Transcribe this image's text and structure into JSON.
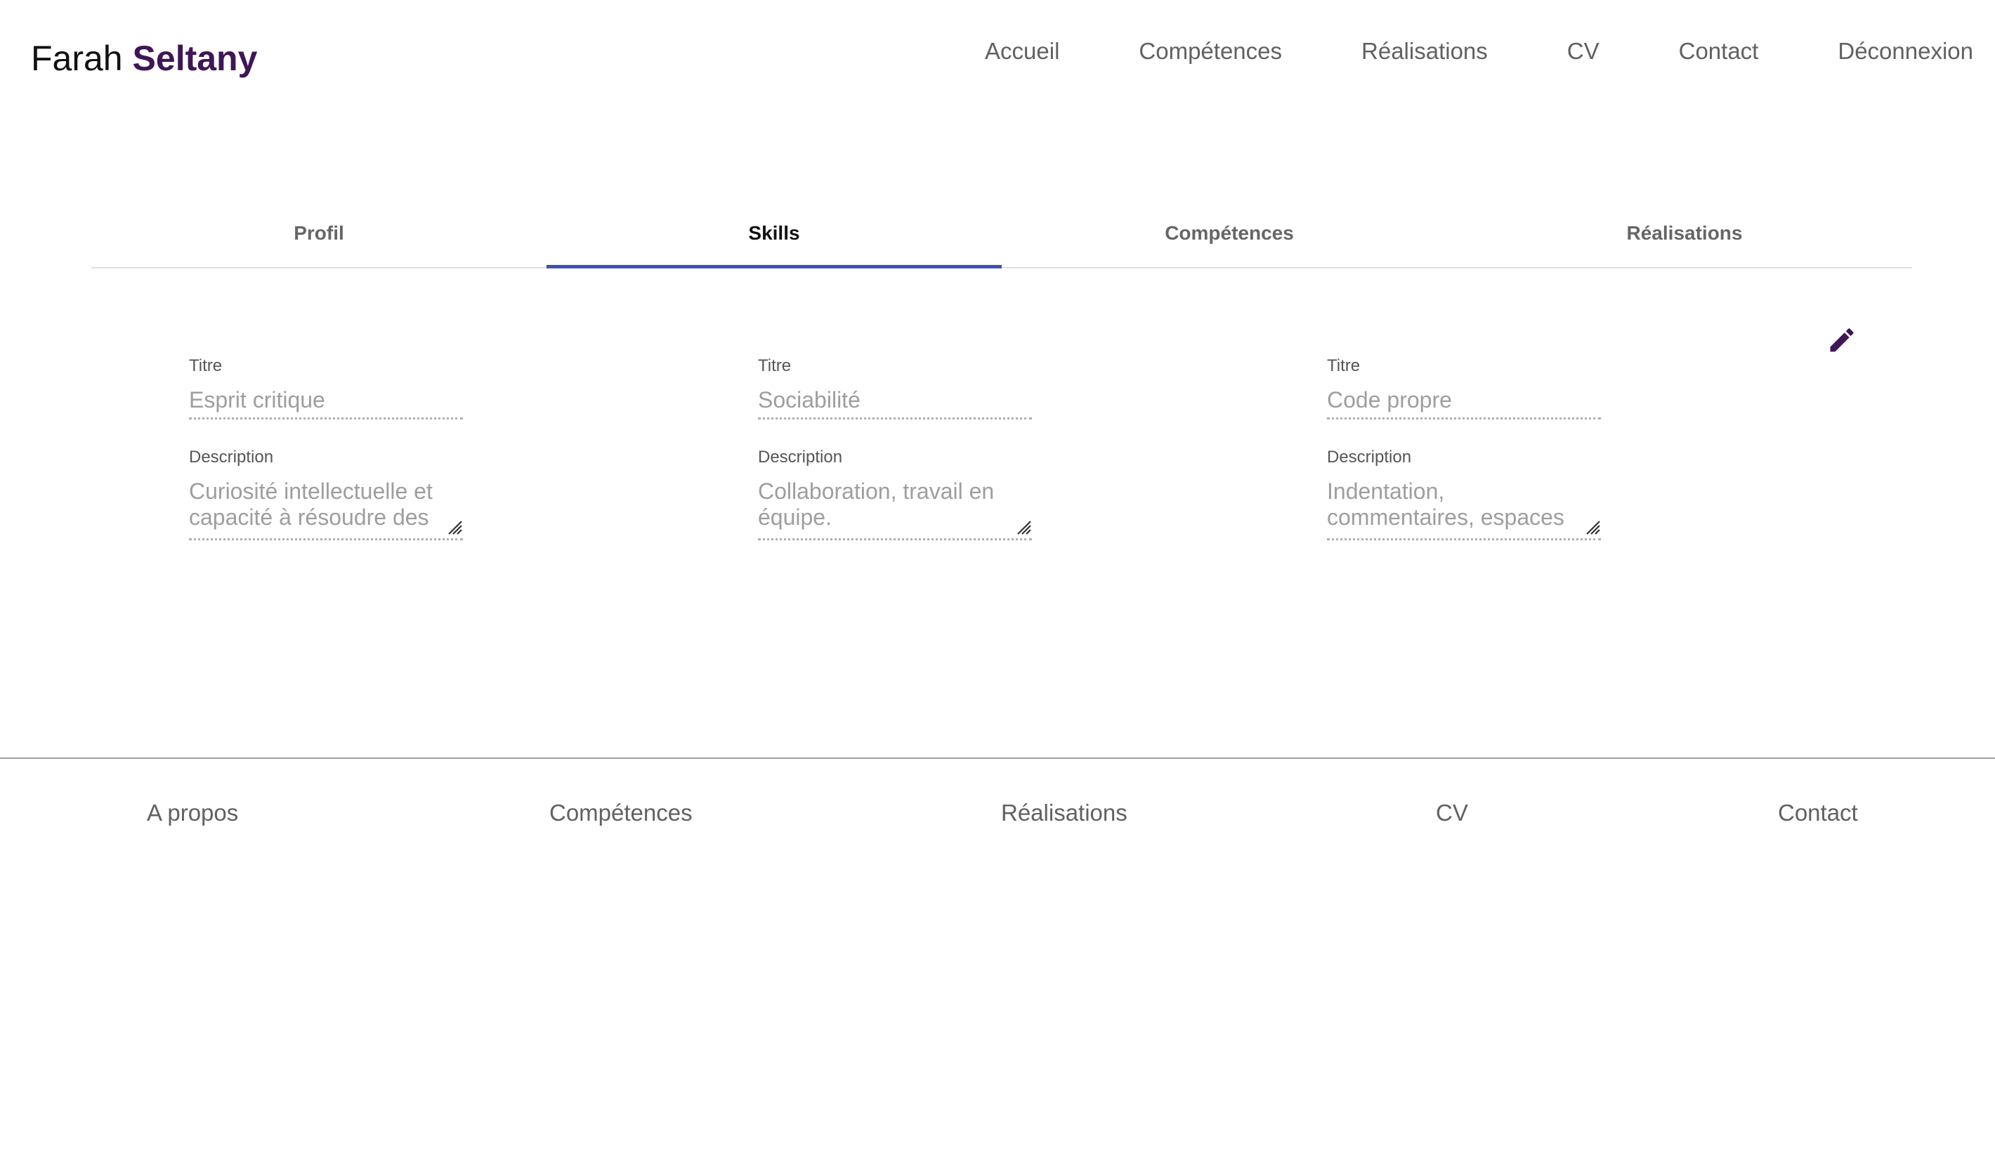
{
  "header": {
    "brand_first": "Farah",
    "brand_last": "Seltany",
    "nav": [
      "Accueil",
      "Compétences",
      "Réalisations",
      "CV",
      "Contact",
      "Déconnexion"
    ]
  },
  "tabs": [
    {
      "label": "Profil",
      "active": false
    },
    {
      "label": "Skills",
      "active": true
    },
    {
      "label": "Compétences",
      "active": false
    },
    {
      "label": "Réalisations",
      "active": false
    }
  ],
  "edit_icon": "pencil-icon",
  "skills": [
    {
      "title_label": "Titre",
      "title_value": "Esprit critique",
      "desc_label": "Description",
      "desc_value": "Curiosité intellectuelle et capacité à résoudre des"
    },
    {
      "title_label": "Titre",
      "title_value": "Sociabilité",
      "desc_label": "Description",
      "desc_value": "Collaboration, travail en équipe."
    },
    {
      "title_label": "Titre",
      "title_value": "Code propre",
      "desc_label": "Description",
      "desc_value": "Indentation, commentaires, espaces ..."
    }
  ],
  "footer": {
    "links": [
      "A propos",
      "Compétences",
      "Réalisations",
      "CV",
      "Contact"
    ]
  },
  "colors": {
    "brand_accent": "#3f1656",
    "tab_indicator": "#3f51b5",
    "nav_text": "#616161",
    "field_text": "#9e9e9e"
  }
}
